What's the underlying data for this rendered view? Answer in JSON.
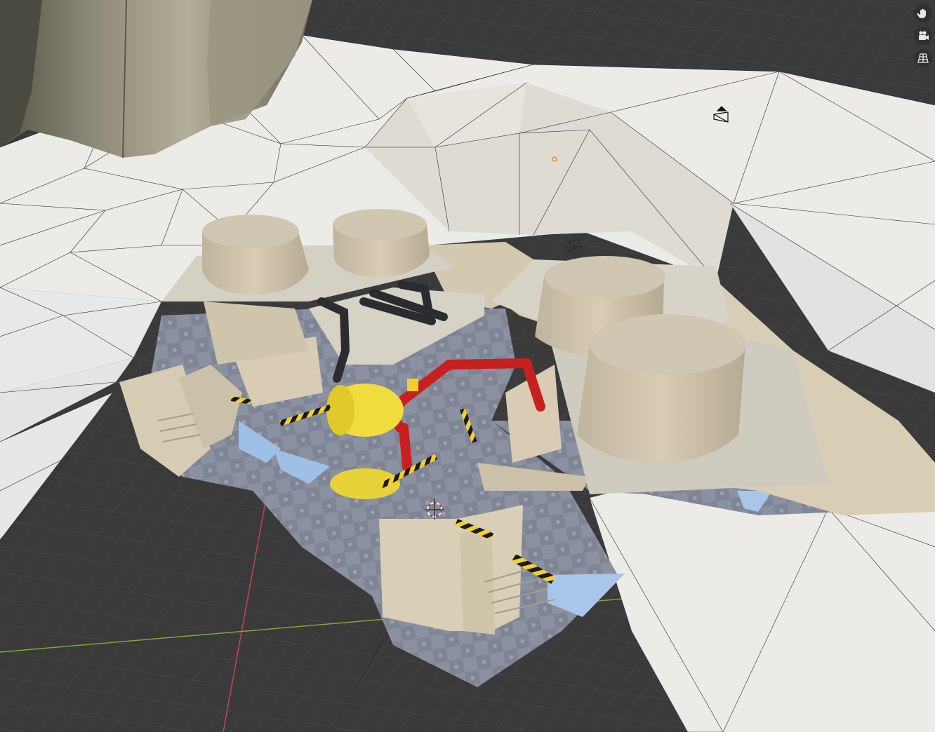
{
  "app": {
    "view": "3D Viewport"
  },
  "viewport": {
    "background": "#3a3a3a",
    "grid_color": "#4a4a4a",
    "x_axis_color": "#c24a4a",
    "y_axis_color": "#7aa83a",
    "terrain_color": "#ecebe8",
    "wall_color": "#d9cfb9",
    "floor_color": "#8d93a1",
    "pipe_red": "#c81f1f",
    "tank_yellow": "#f0dc3c",
    "hazard_yellow": "#f2d22a"
  },
  "nav_gizmo": {
    "items": [
      {
        "icon": "hand-pan-icon"
      },
      {
        "icon": "camera-view-icon"
      },
      {
        "icon": "grid-ortho-icon"
      }
    ]
  },
  "scene_objects": {
    "tanks": [
      {
        "name": "tank-left-1"
      },
      {
        "name": "tank-left-2"
      },
      {
        "name": "tank-right-1"
      },
      {
        "name": "tank-right-2"
      }
    ]
  }
}
